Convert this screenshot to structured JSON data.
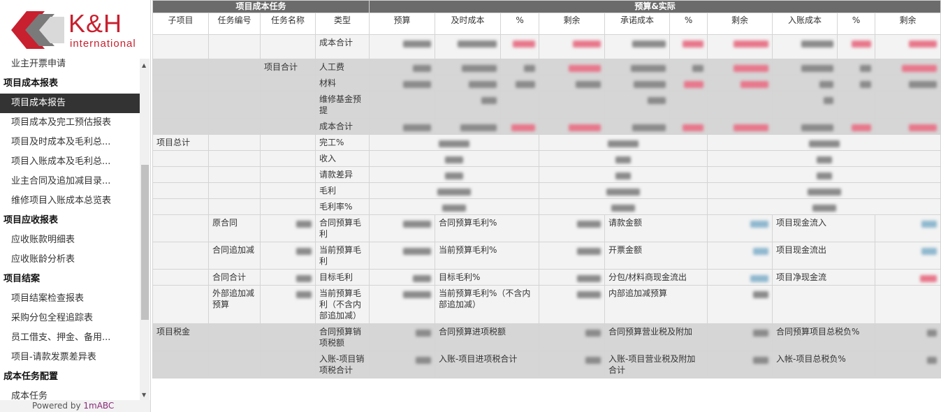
{
  "brand": {
    "name": "K&H",
    "tagline": "international",
    "primary_color": "#c8202f"
  },
  "sidebar": {
    "items": [
      {
        "type": "item",
        "label": "业主开票申请"
      },
      {
        "type": "group",
        "label": "项目成本报表"
      },
      {
        "type": "item",
        "label": "项目成本报告",
        "active": true
      },
      {
        "type": "item",
        "label": "项目成本及完工预估报表"
      },
      {
        "type": "item",
        "label": "项目及时成本及毛利总..."
      },
      {
        "type": "item",
        "label": "项目入账成本及毛利总..."
      },
      {
        "type": "item",
        "label": "业主合同及追加减目录..."
      },
      {
        "type": "item",
        "label": "维修项目入账成本总览表"
      },
      {
        "type": "group",
        "label": "项目应收报表"
      },
      {
        "type": "item",
        "label": "应收账款明细表"
      },
      {
        "type": "item",
        "label": "应收账龄分析表"
      },
      {
        "type": "group",
        "label": "项目结案"
      },
      {
        "type": "item",
        "label": "项目结案检查报表"
      },
      {
        "type": "item",
        "label": "采购分包全程追踪表"
      },
      {
        "type": "item",
        "label": "员工借支、押金、备用..."
      },
      {
        "type": "item",
        "label": "项目-请款发票差异表"
      },
      {
        "type": "group",
        "label": "成本任务配置"
      },
      {
        "type": "item",
        "label": "成本任务"
      }
    ],
    "powered_prefix": "Powered by ",
    "powered_brand": "1mABC"
  },
  "table": {
    "group_headers": [
      "项目成本任务",
      "预算&实际"
    ],
    "columns": [
      "子项目",
      "任务编号",
      "任务名称",
      "类型",
      "预算",
      "及时成本",
      "%",
      "剩余",
      "承诺成本",
      "%",
      "剩余",
      "入账成本",
      "%",
      "剩余"
    ],
    "labels": {
      "cost_total": "成本合计",
      "project_total": "项目合计",
      "labor": "人工费",
      "material": "材料",
      "maintenance_fund": "维修基金预提",
      "grand_total": "项目总计",
      "completion_pct": "完工%",
      "revenue": "收入",
      "billing_diff": "请款差异",
      "gross_profit": "毛利",
      "gross_margin": "毛利率%",
      "original_contract": "原合同",
      "contract_adj": "合同追加减",
      "contract_total": "合同合计",
      "external_adj_budget": "外部追加减预算",
      "contract_budget_gp": "合同预算毛利",
      "contract_budget_gp_pct": "合同预算毛利%",
      "billing_amount": "请款金额",
      "project_cash_in": "项目现金流入",
      "current_budget_gp": "当前预算毛利",
      "current_budget_gp_pct": "当前预算毛利%",
      "invoice_amount": "开票金额",
      "project_cash_out": "项目现金流出",
      "target_gp": "目标毛利",
      "target_gp_pct": "目标毛利%",
      "sub_material_cash_out": "分包/材料商现金流出",
      "project_net_cash": "项目净现金流",
      "current_budget_gp_excl": "当前预算毛利（不含内部追加减）",
      "current_budget_gp_pct_excl": "当前预算毛利%（不含内部追加减）",
      "internal_adj_budget": "内部追加减预算",
      "project_tax": "项目税金",
      "contract_budget_sales_tax": "合同预算销项税额",
      "contract_budget_input_tax": "合同预算进项税额",
      "contract_budget_business_tax": "合同预算营业税及附加",
      "contract_budget_total_tax_pct": "合同预算项目总税负%",
      "posted_sales_tax_total": "入账-项目销项税合计",
      "posted_input_tax_total": "入账-项目进项税合计",
      "posted_business_tax_total": "入账-项目营业税及附加合计",
      "posted_total_tax_pct": "入帐-项目总税负%"
    }
  }
}
